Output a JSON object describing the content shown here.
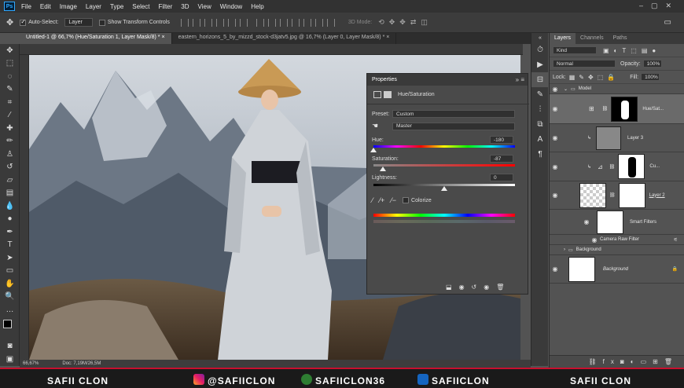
{
  "app": {
    "logo": "Ps"
  },
  "menu": [
    "File",
    "Edit",
    "Image",
    "Layer",
    "Type",
    "Select",
    "Filter",
    "3D",
    "View",
    "Window",
    "Help"
  ],
  "options": {
    "auto_select": "Auto-Select:",
    "auto_select_value": "Layer",
    "transform": "Show Transform Controls",
    "mode3d": "3D Mode:"
  },
  "tabs": [
    {
      "label": "Untitled-1 @ 66,7% (Hue/Saturation 1, Layer Mask/8) *  ×"
    },
    {
      "label": "eastern_horizons_5_by_mizzd_stock-d3jatv5.jpg @ 16,7% (Layer 0, Layer Mask/8) *  ×"
    }
  ],
  "status": {
    "zoom": "66,67%",
    "doc": "Doc: 7,19M/26,5M"
  },
  "properties": {
    "title": "Properties",
    "adjustment": "Hue/Saturation",
    "preset_label": "Preset:",
    "preset_value": "Custom",
    "channel_value": "Master",
    "hue_label": "Hue:",
    "hue_value": "-180",
    "sat_label": "Saturation:",
    "sat_value": "-87",
    "light_label": "Lightness:",
    "light_value": "0",
    "colorize": "Colorize",
    "hue_pos": 0.0,
    "sat_pos": 0.065,
    "light_pos": 0.5
  },
  "layers": {
    "tabs": [
      "Layers",
      "Channels",
      "Paths"
    ],
    "kind": "Kind",
    "blend": "Normal",
    "opacity_label": "Opacity:",
    "opacity_value": "100%",
    "lock_label": "Lock:",
    "fill_label": "Fill:",
    "fill_value": "100%",
    "items": {
      "model": "Model",
      "huesat": "Hue/Sat...",
      "layer3": "Layer 3",
      "cu": "Cu...",
      "layer2": "Layer 2",
      "smart": "Smart Filters",
      "craw": "Camera Raw Filter",
      "bggroup": "Background",
      "bg": "Background"
    }
  },
  "banner": {
    "left": "SAFII CLON",
    "insta": "@SAFIICLON",
    "xbox": "SAFIICLON36",
    "fb": "SAFIICLON",
    "right": "SAFII CLON"
  },
  "colors": {
    "accent": "#31a8ff",
    "banner_red": "#c8102e"
  }
}
